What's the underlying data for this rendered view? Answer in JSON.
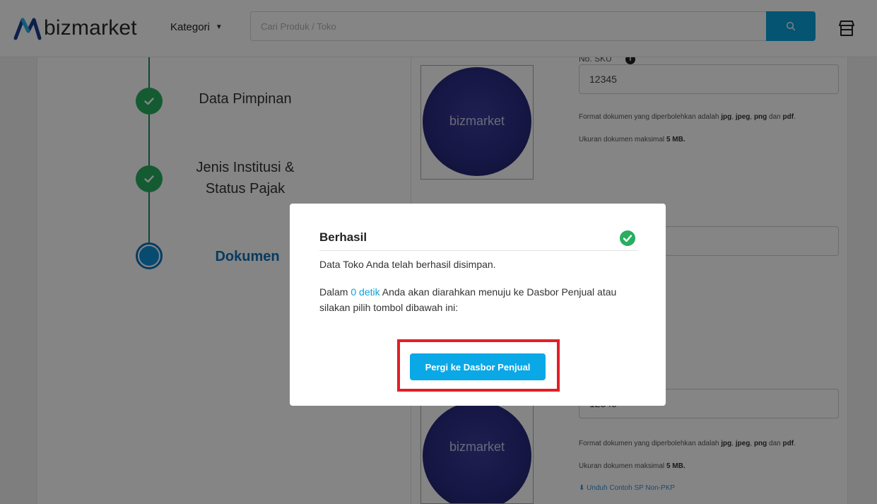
{
  "header": {
    "logo_text": "bizmarket",
    "kategori_label": "Kategori",
    "search_placeholder": "Cari Produk / Toko"
  },
  "steps": [
    {
      "label": "Data Pimpinan",
      "status": "done"
    },
    {
      "label_line1": "Jenis Institusi &",
      "label_line2": "Status Pajak",
      "status": "done"
    },
    {
      "label": "Dokumen",
      "status": "active"
    }
  ],
  "documents": {
    "logo_text": "bizmarket",
    "field_label": "No. SKU",
    "field_value_1": "12345",
    "field_value_2": "12345",
    "help_prefix": "Format dokumen yang diperbolehkan adalah",
    "fmt_jpg": "jpg",
    "fmt_jpeg": "jpeg",
    "fmt_png": "png",
    "fmt_and": "dan",
    "fmt_pdf": "pdf",
    "size_prefix": "Ukuran dokumen maksimal",
    "size_value": "5 MB.",
    "download_link": "Unduh Contoh SP Non-PKP"
  },
  "modal": {
    "title": "Berhasil",
    "message": "Data Toko Anda telah berhasil disimpan.",
    "info_prefix": "Dalam",
    "countdown": "0 detik",
    "info_suffix": "Anda akan diarahkan menuju ke Dasbor Penjual atau silakan pilih tombol dibawah ini:",
    "button_label": "Pergi ke Dasbor Penjual"
  },
  "colors": {
    "accent": "#0aa1d8",
    "success": "#27ae60",
    "step_active": "#0f72b8",
    "highlight": "#e41e26"
  }
}
